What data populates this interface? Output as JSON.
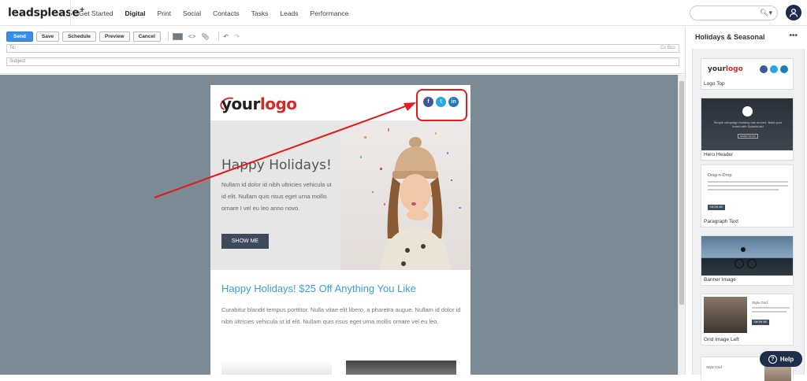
{
  "brand": {
    "name": "leadsplease",
    "plus": "+"
  },
  "nav": {
    "items": [
      "Get Started",
      "Digital",
      "Print",
      "Social",
      "Contacts",
      "Tasks",
      "Leads",
      "Performance"
    ],
    "active": "Digital"
  },
  "search": {
    "placeholder": ""
  },
  "toolbar": {
    "send": "Send",
    "save": "Save",
    "schedule": "Schedule",
    "preview": "Preview",
    "cancel": "Cancel"
  },
  "fields": {
    "to_label": "To:",
    "cc": "Cc  Bcc",
    "subject_label": "Subject"
  },
  "email": {
    "logo_your": "your",
    "logo_logo": "logo",
    "social": [
      "f",
      "t",
      "in"
    ],
    "hero_title": "Happy Holidays!",
    "hero_text": "Nullam id dolor id nibh ultricies vehicula ut id elit. Nullam quis risus eget urna mollis ornare I vel eu leo anno novo.",
    "hero_button": "SHOW ME",
    "section_title": "Happy Holidays!  $25 Off Anything You Like",
    "section_text": "Curabitur blandit tempus porttitor. Nulla vitae elit libero, a pharetra augue. Nullam id dolor id nibh ultricies vehicula ut id elit. Nullam quis risus eget urna mollis ornare vel eu leo."
  },
  "panel": {
    "title": "Holidays & Seasonal",
    "more": "•••",
    "cards": [
      {
        "label": "Logo Top"
      },
      {
        "label": "Hero Header"
      },
      {
        "label": "Paragraph Text"
      },
      {
        "label": "Banner Image"
      },
      {
        "label": "Grid Image Left"
      }
    ],
    "card_texts": {
      "hero": "Simple campaign building has arrived. Build your brand with SplashLab!",
      "hero_btn": "GOOD TO GO",
      "para_heading": "Drag-n-Drop",
      "para_btn": "SHOW ME",
      "grid_heading": "Style Grid",
      "grid_btn": "SHOW ME"
    }
  },
  "help": {
    "label": "Help"
  },
  "colors": {
    "accent": "#3a8ee6",
    "annotation": "#e41b1b",
    "canvas": "#7c8a95"
  }
}
